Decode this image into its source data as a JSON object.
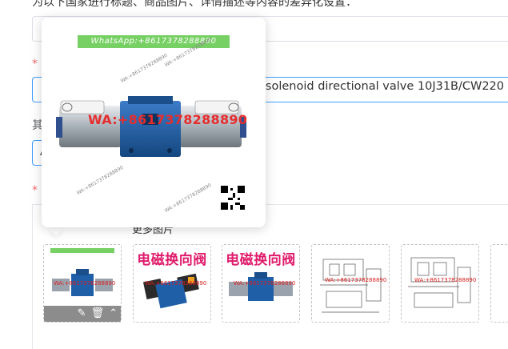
{
  "page": {
    "instruction": "为以下国家进行标题、商品图片、详情描述等内容的差异化设置：",
    "required_mark": "*",
    "other_label": "其",
    "title_value_visible": "5L solenoid directional valve 10J31B/CW220 C",
    "selected_field_value": "A"
  },
  "images_section": {
    "more_images_label": "更多图片",
    "thumbnails": [
      {
        "kind": "photo",
        "caption": "",
        "watermark": "WA:+8617378288890"
      },
      {
        "kind": "photo-title",
        "caption": "电磁换向阀",
        "watermark": "WA:+8617378288890"
      },
      {
        "kind": "photo-title",
        "caption": "电磁换向阀",
        "watermark": "WA:+8617378288890"
      },
      {
        "kind": "drawing",
        "caption": "",
        "watermark": "WA:+8617378288890"
      },
      {
        "kind": "drawing",
        "caption": "",
        "watermark": "WA:+8617378288890"
      }
    ],
    "thumb_actions": {
      "edit": "✎",
      "delete": "🗑",
      "move": "⌃"
    }
  },
  "preview_popup": {
    "whatsapp_strip": "WhatsApp:+8617378288890",
    "watermark_main": "WA:+8617378288890",
    "watermark_small": "WA:+8617378288890"
  },
  "colors": {
    "accent": "#409eff",
    "required": "#f56c6c",
    "watermark_red": "#e62d2d",
    "whatsapp_green": "#77d063",
    "valve_blue": "#1f5fa8"
  }
}
